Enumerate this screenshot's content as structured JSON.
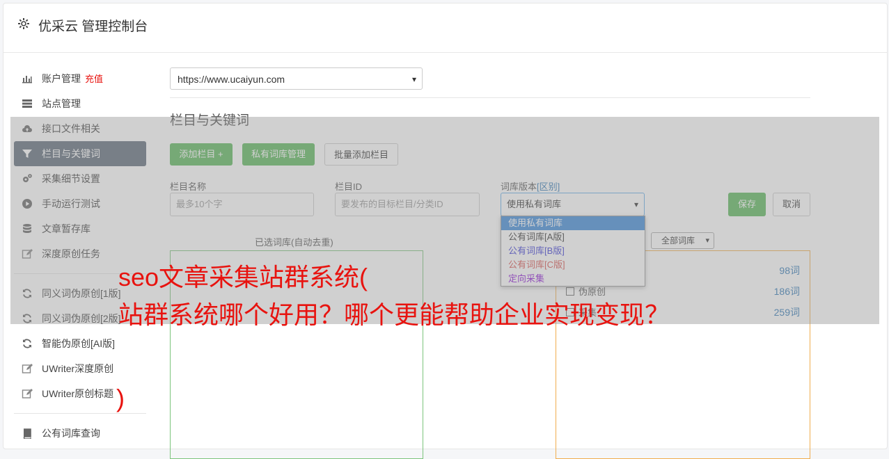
{
  "header": {
    "title": "优采云 管理控制台"
  },
  "sidebar": {
    "items": [
      {
        "label": "账户管理",
        "badge": "充值",
        "icon": "bar-chart-icon"
      },
      {
        "label": "站点管理",
        "icon": "server-icon"
      },
      {
        "label": "接口文件相关",
        "icon": "cloud-upload-icon"
      },
      {
        "label": "栏目与关键词",
        "icon": "filter-icon",
        "active": true
      },
      {
        "label": "采集细节设置",
        "icon": "cogs-icon"
      },
      {
        "label": "手动运行测试",
        "icon": "play-circle-icon"
      },
      {
        "label": "文章暂存库",
        "icon": "database-icon"
      },
      {
        "label": "深度原创任务",
        "icon": "edit-icon"
      },
      {
        "label": "同义词伪原创[1版]",
        "icon": "refresh-icon"
      },
      {
        "label": "同义词伪原创[2版]",
        "icon": "refresh-icon"
      },
      {
        "label": "智能伪原创[AI版]",
        "icon": "refresh-icon"
      },
      {
        "label": "UWriter深度原创",
        "icon": "edit-icon"
      },
      {
        "label": "UWriter原创标题",
        "icon": "edit-icon"
      },
      {
        "label": "公有词库查询",
        "icon": "book-icon"
      }
    ]
  },
  "site_select": {
    "value": "https://www.ucaiyun.com"
  },
  "section": {
    "title": "栏目与关键词"
  },
  "buttons": {
    "add_column": "添加栏目 +",
    "private_lib": "私有词库管理",
    "batch_add": "批量添加栏目",
    "save": "保存",
    "cancel": "取消"
  },
  "form": {
    "name_label": "栏目名称",
    "name_placeholder": "最多10个字",
    "id_label": "栏目ID",
    "id_placeholder": "要发布的目标栏目/分类ID",
    "version_label": "词库版本",
    "version_diff": "[区别]",
    "version_value": "使用私有词库"
  },
  "dropdown": {
    "options": [
      {
        "label": "使用私有词库",
        "color": "#ffffff"
      },
      {
        "label": "公有词库[A版]",
        "color": "#333333"
      },
      {
        "label": "公有词库[B版]",
        "color": "#3b3bd6"
      },
      {
        "label": "公有词库[C版]",
        "color": "#d9534f"
      },
      {
        "label": "定向采集",
        "color": "#8e1bd6"
      }
    ]
  },
  "panels": {
    "selected_label": "已选词库(自动去重)",
    "filter_value": "全部词库",
    "libs": [
      {
        "name": "",
        "count": "98词"
      },
      {
        "name": "伪原创",
        "count": "186词"
      },
      {
        "name": "采集",
        "count": "259词"
      }
    ]
  },
  "overlay": {
    "line1": "seo文章采集站群系统(",
    "line2": "站群系统哪个好用？哪个更能帮助企业实现变现？",
    "line3": ")"
  }
}
